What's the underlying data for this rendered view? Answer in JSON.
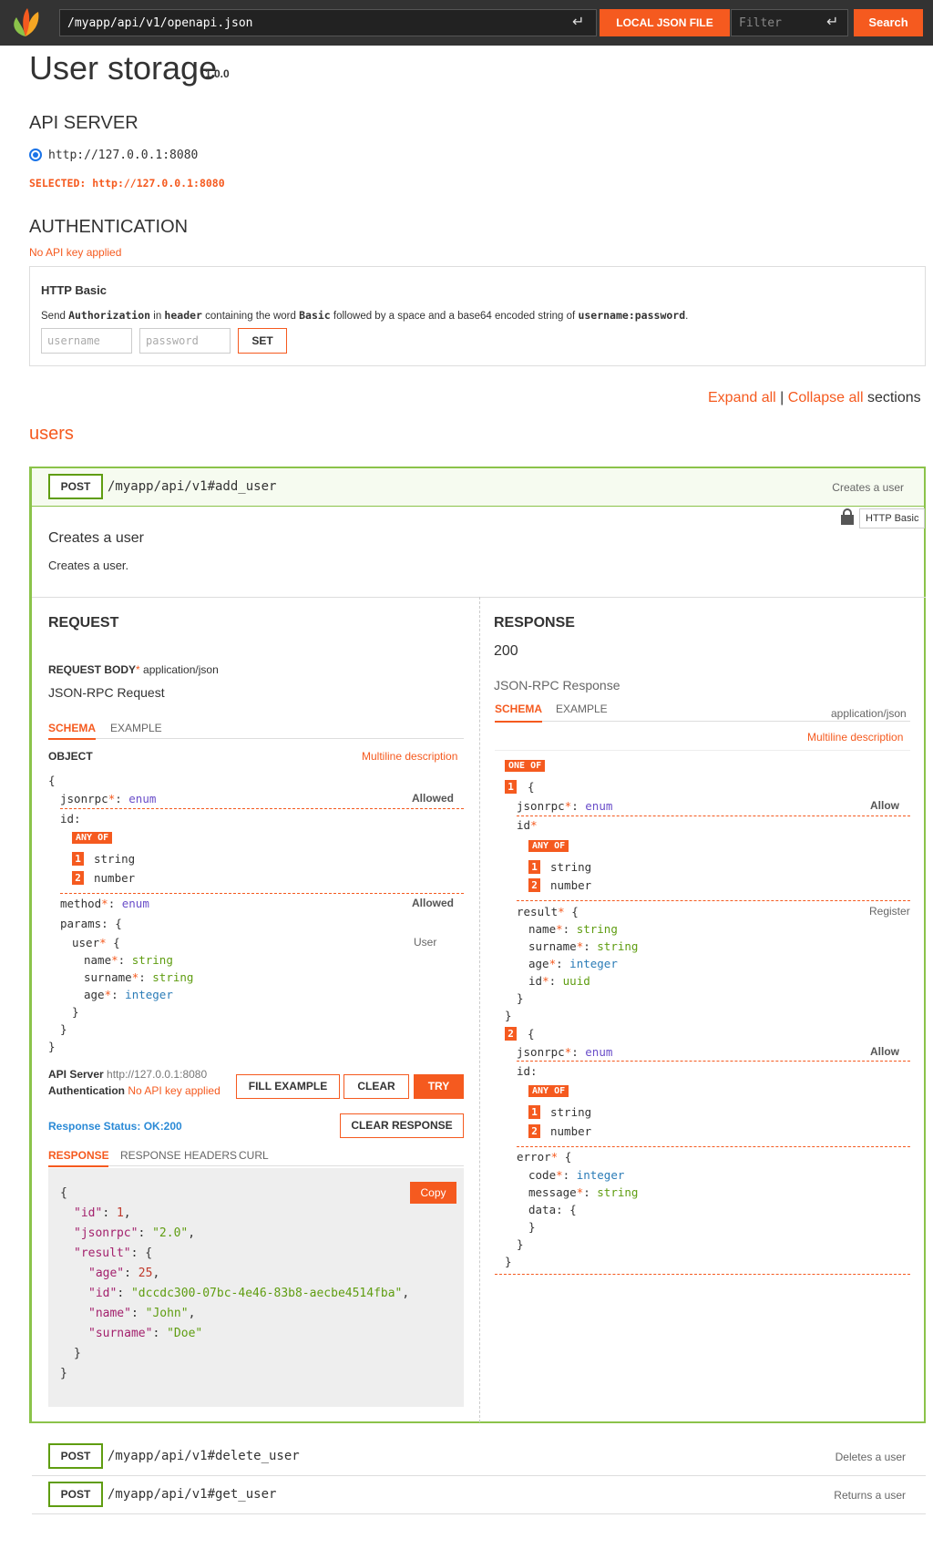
{
  "topbar": {
    "url": "/myapp/api/v1/openapi.json",
    "local_json_label": "LOCAL JSON FILE",
    "filter_placeholder": "Filter",
    "search_label": "Search",
    "enter_glyph": "↵"
  },
  "header": {
    "title": "User storage",
    "version": "1.0.0"
  },
  "api_server": {
    "heading": "API SERVER",
    "option": "http://127.0.0.1:8080",
    "selected_label": "SELECTED:",
    "selected_value": "http://127.0.0.1:8080"
  },
  "authentication": {
    "heading": "AUTHENTICATION",
    "status": "No API key applied",
    "box_title": "HTTP Basic",
    "desc_1": "Send ",
    "desc_authorization": "Authorization",
    "desc_2": " in ",
    "desc_header": "header",
    "desc_3": " containing the word ",
    "desc_basic": "Basic",
    "desc_4": " followed by a space and a base64 encoded string of ",
    "desc_userpass": "username:password",
    "desc_5": ".",
    "username_placeholder": "username",
    "password_placeholder": "password",
    "set_label": "SET"
  },
  "sections": {
    "expand_all": "Expand all",
    "sep": "|",
    "collapse_all": "Collapse all",
    "suffix": "sections"
  },
  "tag_name": "users",
  "operation": {
    "method": "POST",
    "path": "/myapp/api/v1#add_user",
    "summary": "Creates a user",
    "security_tag": "HTTP Basic",
    "title": "Creates a user",
    "description": "Creates a user.",
    "request": {
      "heading": "REQUEST",
      "body_label": "REQUEST BODY",
      "body_type": "application/json",
      "schema_title": "JSON-RPC Request",
      "tab_schema": "SCHEMA",
      "tab_example": "EXAMPLE",
      "object_label": "OBJECT",
      "multiline": "Multiline description",
      "allowed": "Allowed",
      "user_desc": "User",
      "api_server_label": "API Server",
      "api_server_value": "http://127.0.0.1:8080",
      "auth_label": "Authentication",
      "auth_value": "No API key applied",
      "fill_example": "FILL EXAMPLE",
      "clear": "CLEAR",
      "try": "TRY",
      "response_status": "Response Status: OK:200",
      "clear_response": "CLEAR RESPONSE",
      "tab_response": "RESPONSE",
      "tab_headers": "RESPONSE HEADERS",
      "tab_curl": "CURL",
      "copy": "Copy",
      "response_json": {
        "id": "1",
        "jsonrpc": "\"2.0\"",
        "age": "25",
        "uid": "\"dccdc300-07bc-4e46-83b8-aecbe4514fba\"",
        "name": "\"John\"",
        "surname": "\"Doe\""
      }
    },
    "response": {
      "heading": "RESPONSE",
      "code": "200",
      "schema_title": "JSON-RPC Response",
      "tab_schema": "SCHEMA",
      "tab_example": "EXAMPLE",
      "content_type": "application/json",
      "multiline": "Multiline description",
      "one_of": "ONE OF",
      "any_of": "ANY OF",
      "allow": "Allow",
      "register": "Register"
    }
  },
  "other_operations": [
    {
      "method": "POST",
      "path": "/myapp/api/v1#delete_user",
      "summary": "Deletes a user"
    },
    {
      "method": "POST",
      "path": "/myapp/api/v1#get_user",
      "summary": "Returns a user"
    }
  ],
  "colors": {
    "accent": "#f55a1f",
    "post_border": "#5f9d11",
    "type_green": "#5f9d11",
    "type_blue": "#2b7cb7",
    "enum_purple": "#6a4ec9"
  }
}
